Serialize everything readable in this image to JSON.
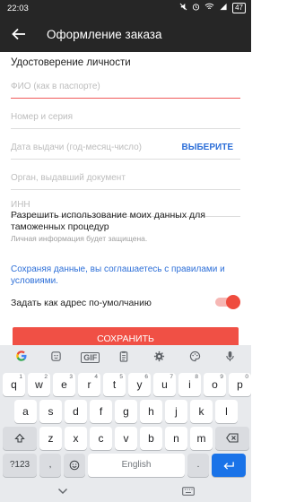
{
  "status_bar": {
    "time": "22:03",
    "battery": "47"
  },
  "app_bar": {
    "title": "Оформление заказа"
  },
  "form": {
    "section_title": "Удостоверение личности",
    "full_name_placeholder": "ФИО (как в паспорте)",
    "passport_placeholder": "Номер и серия",
    "issue_date_placeholder": "Дата выдачи (год-месяц-число)",
    "issue_date_action": "ВЫБЕРИТЕ",
    "issuer_placeholder": "Орган, выдавший документ",
    "inn_placeholder": "ИНН",
    "permission_text": "Разрешить использование моих данных для таможенных процедур",
    "protection_note": "Личная информация будет защищена.",
    "terms_text": "Сохраняя данные, вы соглашаетесь с правилами и условиями.",
    "default_address_label": "Задать как адрес по-умолчанию",
    "default_address_on": true,
    "save_label": "СОХРАНИТЬ",
    "accent_color": "#f05045",
    "link_color": "#2d6fd8"
  },
  "keyboard": {
    "toolbar": [
      "G",
      "sticker-icon",
      "GIF",
      "clipboard-icon",
      "settings-icon",
      "palette-icon",
      "mic-icon"
    ],
    "gif_label": "GIF",
    "row1": [
      {
        "k": "q",
        "n": "1"
      },
      {
        "k": "w",
        "n": "2"
      },
      {
        "k": "e",
        "n": "3"
      },
      {
        "k": "r",
        "n": "4"
      },
      {
        "k": "t",
        "n": "5"
      },
      {
        "k": "y",
        "n": "6"
      },
      {
        "k": "u",
        "n": "7"
      },
      {
        "k": "i",
        "n": "8"
      },
      {
        "k": "o",
        "n": "9"
      },
      {
        "k": "p",
        "n": "0"
      }
    ],
    "row2": [
      "a",
      "s",
      "d",
      "f",
      "g",
      "h",
      "j",
      "k",
      "l"
    ],
    "row3": [
      "z",
      "x",
      "c",
      "v",
      "b",
      "n",
      "m"
    ],
    "sym_label": "?123",
    "comma": ",",
    "space_label": "English",
    "period": "."
  }
}
